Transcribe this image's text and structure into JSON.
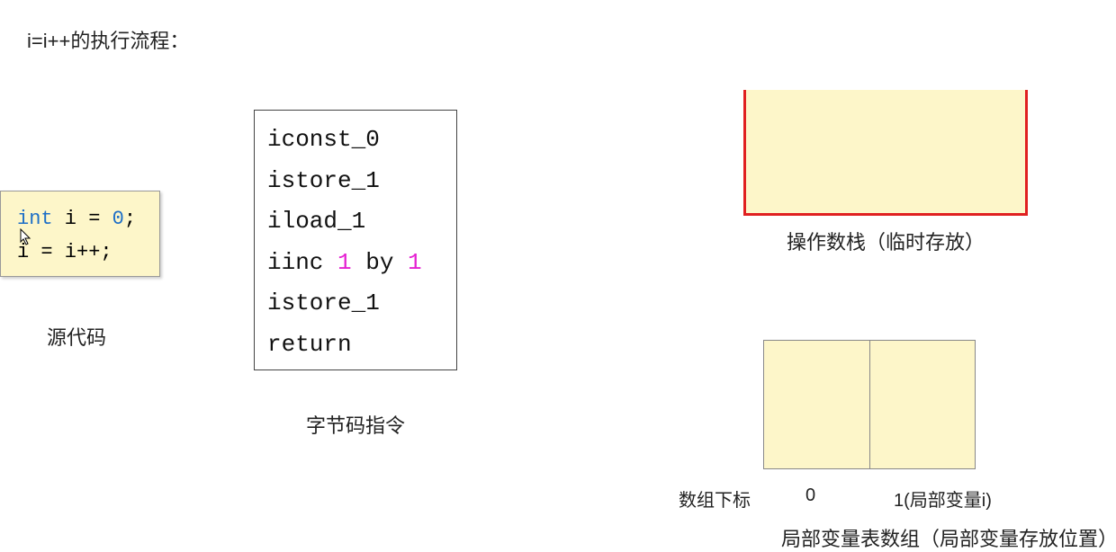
{
  "title": "i=i++的执行流程：",
  "source": {
    "line1_kw": "int",
    "line1_rest": " i = ",
    "line1_num": "0",
    "line1_end": ";",
    "line2": "i = i++;",
    "label": "源代码"
  },
  "bytecode": {
    "l1": "iconst_0",
    "l2": "istore_1",
    "l3": "iload_1",
    "l4_a": "iinc ",
    "l4_n1": "1",
    "l4_b": " by ",
    "l4_n2": "1",
    "l5": "istore_1",
    "l6": "return",
    "label": "字节码指令"
  },
  "stack": {
    "label": "操作数栈（临时存放）"
  },
  "lvt": {
    "index_label": "数组下标",
    "idx0": "0",
    "idx1": "1(局部变量i)",
    "label": "局部变量表数组（局部变量存放位置）"
  },
  "watermark": ""
}
